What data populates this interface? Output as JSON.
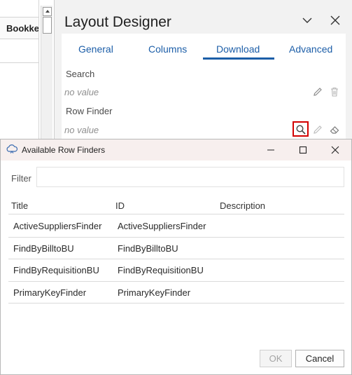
{
  "background_sheet": {
    "column_header": "Bookkeeping"
  },
  "designer": {
    "title": "Layout Designer",
    "tabs": [
      "General",
      "Columns",
      "Download",
      "Advanced"
    ],
    "active_tab": "Download",
    "fields": [
      {
        "label": "Search",
        "value": "no value"
      },
      {
        "label": "Row Finder",
        "value": "no value"
      }
    ]
  },
  "dialog": {
    "title": "Available Row Finders",
    "filter_label": "Filter",
    "filter_value": "",
    "columns": [
      "Title",
      "ID",
      "Description"
    ],
    "rows": [
      {
        "title": "ActiveSuppliersFinder",
        "id": "ActiveSuppliersFinder",
        "description": ""
      },
      {
        "title": "FindByBilltoBU",
        "id": "FindByBilltoBU",
        "description": ""
      },
      {
        "title": "FindByRequisitionBU",
        "id": "FindByRequisitionBU",
        "description": ""
      },
      {
        "title": "PrimaryKeyFinder",
        "id": "PrimaryKeyFinder",
        "description": ""
      }
    ],
    "ok_label": "OK",
    "cancel_label": "Cancel"
  },
  "colors": {
    "accent": "#1c5ea8",
    "highlight_box": "#d30000",
    "dialog_titlebar": "#f7efee",
    "panel_bg": "#f2f2f2"
  },
  "icons": {
    "collapse": "chevron-down-icon",
    "close": "close-icon",
    "edit": "pencil-icon",
    "delete": "trash-icon",
    "search": "search-icon",
    "clear": "eraser-icon",
    "app": "cloud-app-icon",
    "minimize": "minimize-icon",
    "maximize": "maximize-icon"
  }
}
